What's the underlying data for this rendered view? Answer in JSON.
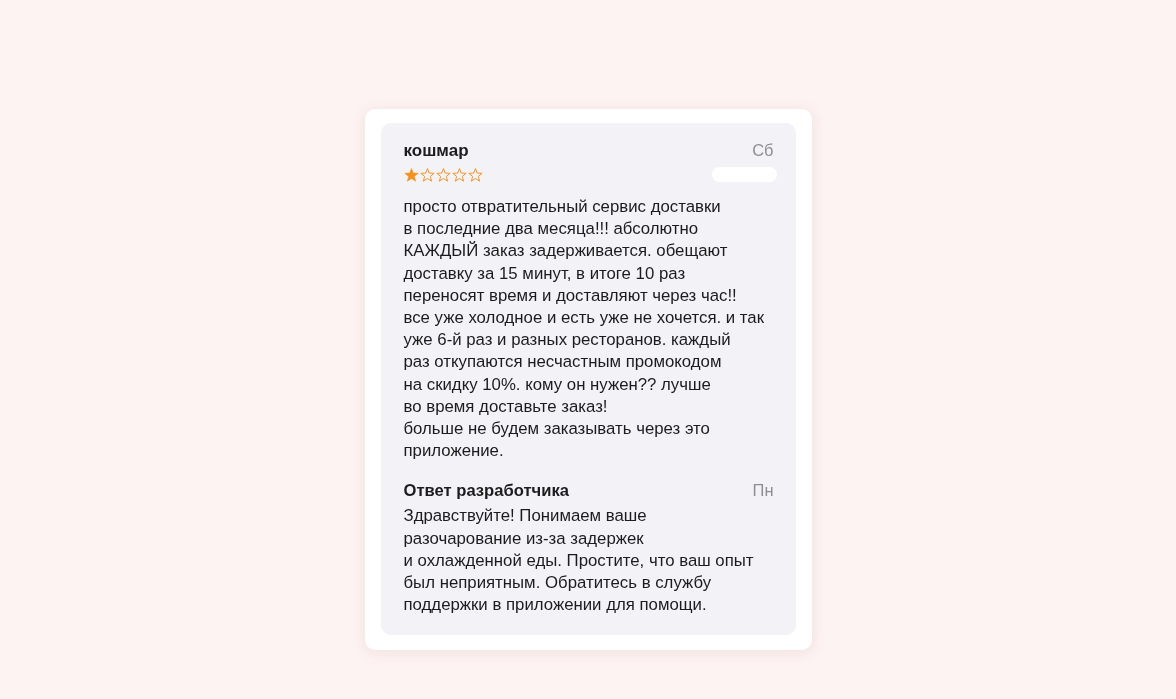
{
  "review": {
    "title": "кошмар",
    "date": "Сб",
    "stars": 1,
    "text": "просто отвратительный сервис доставки\nв последние два месяца!!! абсолютно\nКАЖДЫЙ заказ задерживается. обещают\nдоставку за 15 минут, в итоге 10 раз\nпереносят время и доставляют через час!!\nвсе уже холодное и есть уже не хочется. и так\nуже 6-й раз и разных ресторанов. каждый\nраз откупаются несчастным промокодом\nна скидку 10%. кому он нужен?? лучше\nво время доставьте заказ!\nбольше не будем заказывать через это\nприложение."
  },
  "developer_response": {
    "title": "Ответ разработчика",
    "date": "Пн",
    "text": "Здравствуйте! Понимаем ваше\nразочарование из-за задержек\nи охлажденной еды. Простите, что ваш опыт\nбыл неприятным. Обратитесь в службу\nподдержки в приложении для помощи."
  }
}
